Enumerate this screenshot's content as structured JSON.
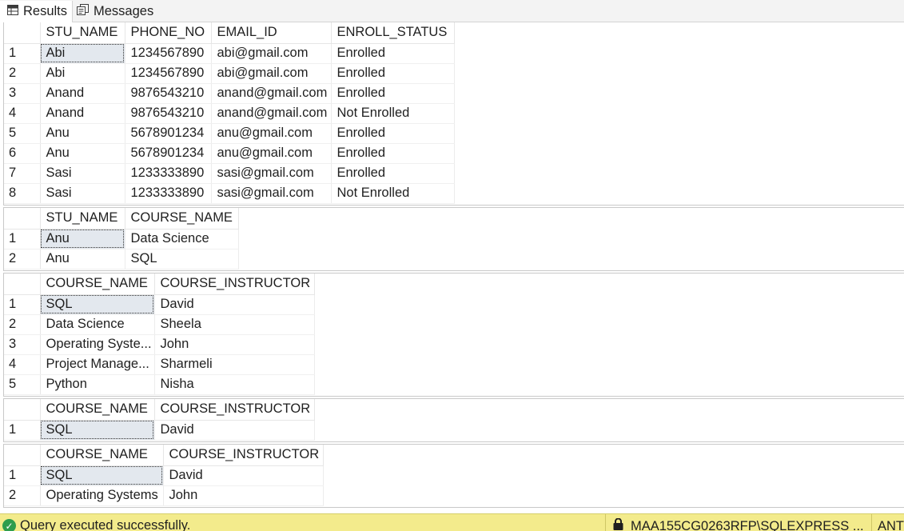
{
  "tabs": {
    "results_label": "Results",
    "messages_label": "Messages"
  },
  "grids": {
    "students": {
      "columns": [
        "STU_NAME",
        "PHONE_NO",
        "EMAIL_ID",
        "ENROLL_STATUS"
      ],
      "rows": [
        [
          "1",
          "Abi",
          "1234567890",
          "abi@gmail.com",
          "Enrolled"
        ],
        [
          "2",
          "Abi",
          "1234567890",
          "abi@gmail.com",
          "Enrolled"
        ],
        [
          "3",
          "Anand",
          "9876543210",
          "anand@gmail.com",
          "Enrolled"
        ],
        [
          "4",
          "Anand",
          "9876543210",
          "anand@gmail.com",
          "Not Enrolled"
        ],
        [
          "5",
          "Anu",
          "5678901234",
          "anu@gmail.com",
          "Enrolled"
        ],
        [
          "6",
          "Anu",
          "5678901234",
          "anu@gmail.com",
          "Enrolled"
        ],
        [
          "7",
          "Sasi",
          "1233333890",
          "sasi@gmail.com",
          "Enrolled"
        ],
        [
          "8",
          "Sasi",
          "1233333890",
          "sasi@gmail.com",
          "Not Enrolled"
        ]
      ]
    },
    "student_courses": {
      "columns": [
        "STU_NAME",
        "COURSE_NAME"
      ],
      "rows": [
        [
          "1",
          "Anu",
          "Data Science"
        ],
        [
          "2",
          "Anu",
          "SQL"
        ]
      ]
    },
    "courses": {
      "columns": [
        "COURSE_NAME",
        "COURSE_INSTRUCTOR"
      ],
      "rows": [
        [
          "1",
          "SQL",
          "David"
        ],
        [
          "2",
          "Data Science",
          "Sheela"
        ],
        [
          "3",
          "Operating Syste...",
          "John"
        ],
        [
          "4",
          "Project Manage...",
          "Sharmeli"
        ],
        [
          "5",
          "Python",
          "Nisha"
        ]
      ]
    },
    "courses_filtered_a": {
      "columns": [
        "COURSE_NAME",
        "COURSE_INSTRUCTOR"
      ],
      "rows": [
        [
          "1",
          "SQL",
          "David"
        ]
      ]
    },
    "courses_filtered_b": {
      "columns": [
        "COURSE_NAME",
        "COURSE_INSTRUCTOR"
      ],
      "rows": [
        [
          "1",
          "SQL",
          "David"
        ],
        [
          "2",
          "Operating Systems",
          "John"
        ]
      ]
    }
  },
  "status": {
    "message": "Query executed successfully.",
    "server": "MAA155CG0263RFP\\SQLEXPRESS ...",
    "user": "ANT",
    "bar_color": "#f3eb8c",
    "success_color": "#2e9d4d"
  },
  "icons": {
    "results": "grid-icon",
    "messages": "messages-icon",
    "success": "check-circle-icon",
    "connection": "lock-icon"
  }
}
